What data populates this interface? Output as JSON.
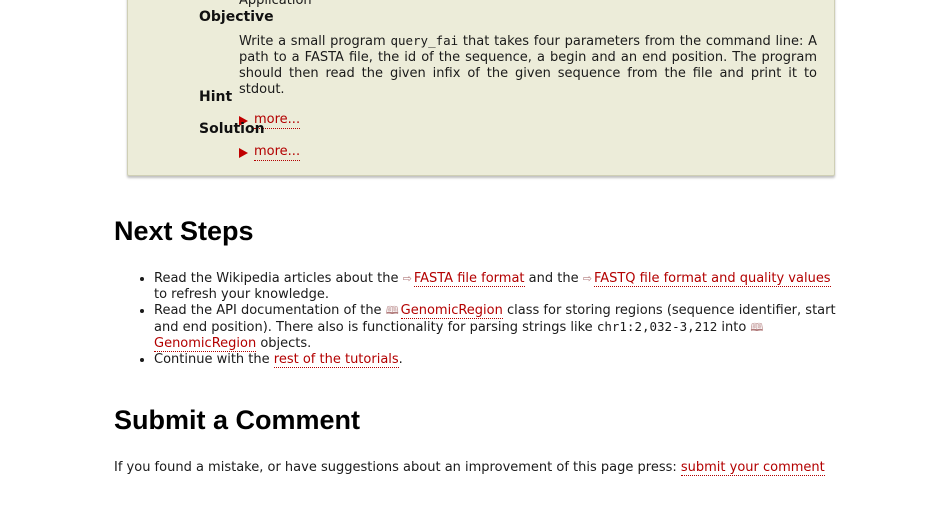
{
  "assignment": {
    "type_value": "Application",
    "objective_label": "Objective",
    "objective_text_1": "Write a small program ",
    "objective_code": "query_fai",
    "objective_text_2": " that takes four parameters from the command line: A path to a FASTA file, the id of the sequence, a begin and an end position. The program should then read the given infix of the given sequence from the file and print it to stdout.",
    "hint_label": "Hint",
    "hint_more": "more...",
    "solution_label": "Solution",
    "solution_more": "more..."
  },
  "next_steps": {
    "heading": "Next Steps",
    "item1": {
      "text_1": "Read the Wikipedia articles about the ",
      "link_1": "FASTA file format",
      "text_2": " and the ",
      "link_2": "FASTQ file format and quality values",
      "text_3": " to refresh your knowledge."
    },
    "item2": {
      "text_1": "Read the API documentation of the ",
      "link_1": "GenomicRegion",
      "text_2": " class for storing regions (sequence identifier, start and end position). There also is functionality for parsing strings like ",
      "code": "chr1:2,032-3,212",
      "text_3": " into ",
      "link_2": "GenomicRegion",
      "text_4": " objects."
    },
    "item3": {
      "text_1": "Continue with the ",
      "link_1": "rest of the tutorials",
      "text_2": "."
    }
  },
  "comment": {
    "heading": "Submit a Comment",
    "text": "If you found a mistake, or have suggestions about an improvement of this page press: ",
    "link": "submit your comment"
  },
  "icons": {
    "external_link": "external-link-icon",
    "api_doc": "book-icon",
    "expand": "triangle-right-icon"
  },
  "colors": {
    "link": "#b30000",
    "box_background": "#ececd9",
    "triangle": "#c00000"
  }
}
